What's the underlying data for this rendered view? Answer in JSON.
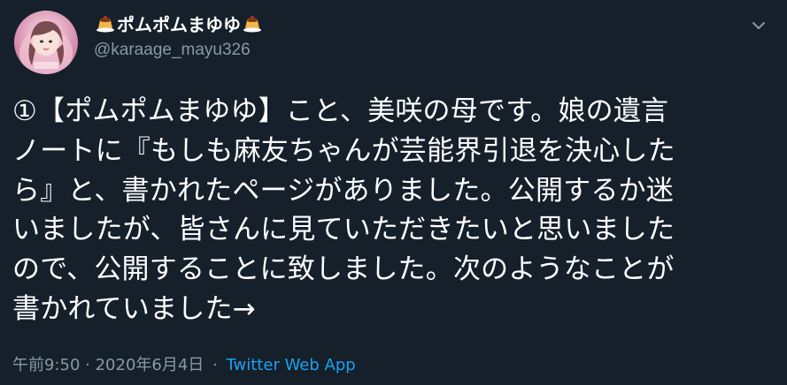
{
  "tweet": {
    "author": {
      "display_name": "ポムポムまゆゆ",
      "handle": "@karaage_mayu326",
      "decoration_icon": "pudding-icon"
    },
    "menu_icon": "chevron-down-icon",
    "body_lines": [
      "①【ポムポムまゆゆ】こと、美咲の母です。娘の遺言",
      "ノートに『もしも麻友ちゃんが芸能界引退を決心した",
      "ら』と、書かれたページがありました。公開するか迷",
      "いましたが、皆さんに見ていただきたいと思いました",
      "ので、公開することに致しました。次のようなことが",
      "書かれていました→"
    ],
    "timestamp": "午前9:50 · 2020年6月4日",
    "separator": "·",
    "source_app": "Twitter Web App"
  },
  "colors": {
    "background": "#15202b",
    "text": "#ffffff",
    "secondary": "#8899a6",
    "link": "#1da1f2"
  }
}
